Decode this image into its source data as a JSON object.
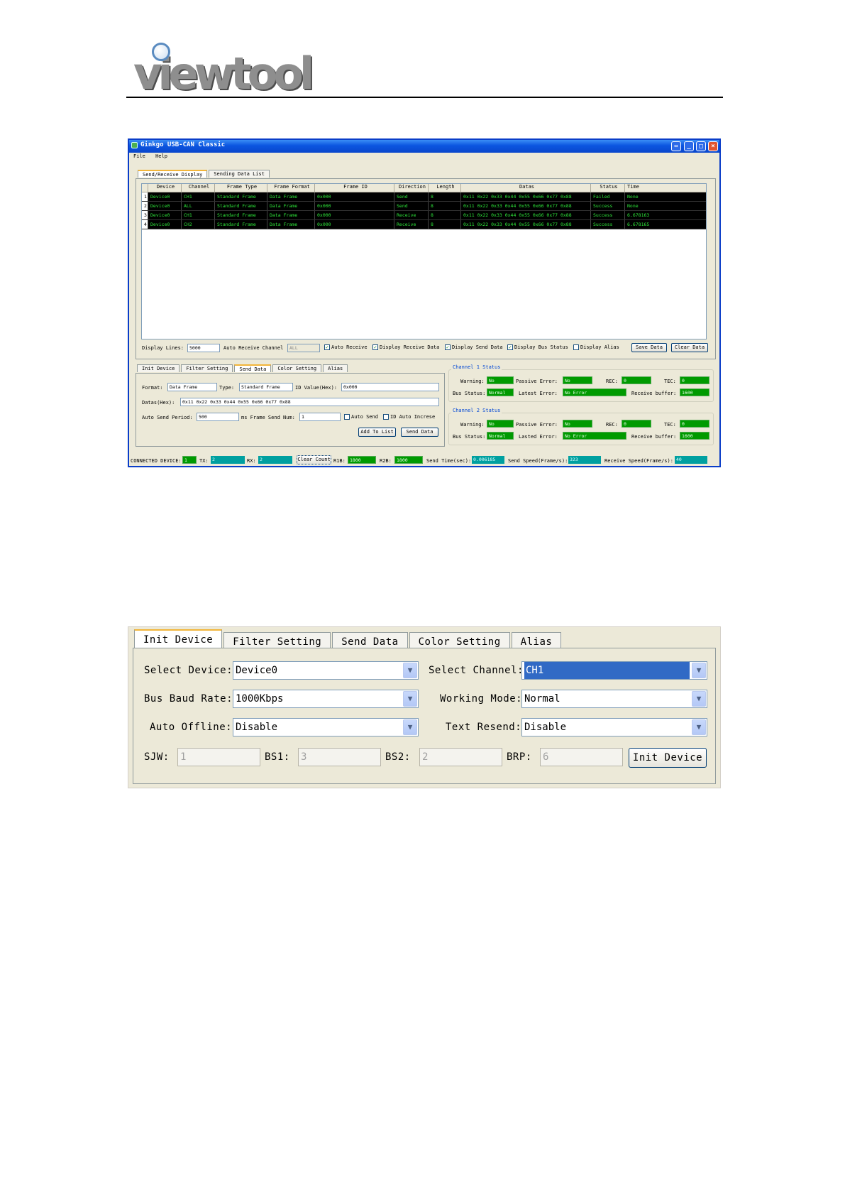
{
  "logo": {
    "text": "viewtool"
  },
  "win1": {
    "title": "Ginkgo USB-CAN Classic",
    "menu": [
      "File",
      "Help"
    ],
    "main_tabs": [
      "Send/Receive Display",
      "Sending Data List"
    ],
    "grid": {
      "columns": [
        "Device",
        "Channel",
        "Frame Type",
        "Frame Format",
        "Frame ID",
        "Direction",
        "Length",
        "Datas",
        "Status",
        "Time"
      ],
      "rows": [
        {
          "n": "1",
          "device": "Device0",
          "channel": "CH1",
          "type": "Standard Frame",
          "format": "Data Frame",
          "id": "0x000",
          "dir": "Send",
          "len": "8",
          "data": "0x11 0x22 0x33 0x44 0x55 0x66 0x77 0x88",
          "status": "Failed",
          "time": "None"
        },
        {
          "n": "2",
          "device": "Device0",
          "channel": "ALL",
          "type": "Standard Frame",
          "format": "Data Frame",
          "id": "0x000",
          "dir": "Send",
          "len": "8",
          "data": "0x11 0x22 0x33 0x44 0x55 0x66 0x77 0x88",
          "status": "Success",
          "time": "None"
        },
        {
          "n": "3",
          "device": "Device0",
          "channel": "CH1",
          "type": "Standard Frame",
          "format": "Data Frame",
          "id": "0x000",
          "dir": "Receive",
          "len": "8",
          "data": "0x11 0x22 0x33 0x44 0x55 0x66 0x77 0x88",
          "status": "Success",
          "time": "6.678163"
        },
        {
          "n": "4",
          "device": "Device0",
          "channel": "CH2",
          "type": "Standard Frame",
          "format": "Data Frame",
          "id": "0x000",
          "dir": "Receive",
          "len": "8",
          "data": "0x11 0x22 0x33 0x44 0x55 0x66 0x77 0x88",
          "status": "Success",
          "time": "6.678165"
        }
      ]
    },
    "display_bar": {
      "lines_label": "Display Lines:",
      "lines_value": "5000",
      "auto_recv_label": "Auto Receive Channel",
      "auto_recv_value": "ALL",
      "auto_receive": "Auto Receive",
      "display_receive": "Display Receive Data",
      "display_send": "Display Send Data",
      "display_bus": "Display Bus Status",
      "display_alias": "Display Alias",
      "save": "Save Data",
      "clear": "Clear Data"
    },
    "lower_tabs": [
      "Init Device",
      "Filter Setting",
      "Send Data",
      "Color Setting",
      "Alias"
    ],
    "send": {
      "format_label": "Format:",
      "format_value": "Data Frame",
      "type_label": "Type:",
      "type_value": "Standard Frame",
      "id_label": "ID Value(Hex):",
      "id_value": "0x000",
      "datas_label": "Datas(Hex):",
      "datas_value": "0x11 0x22 0x33 0x44 0x55 0x66 0x77 0x88",
      "period_label": "Auto Send Period:",
      "period_value": "500",
      "num_label": "ms Frame Send Num:",
      "num_value": "1",
      "auto_send": "Auto Send",
      "id_auto": "ID Auto Increse",
      "add": "Add To List",
      "send": "Send Data"
    },
    "ch1": {
      "title": "Channel 1 Status",
      "warning_l": "Warning:",
      "warning": "No",
      "passive_l": "Passive Error:",
      "passive": "No",
      "rec_l": "REC:",
      "rec": "0",
      "tec_l": "TEC:",
      "tec": "0",
      "bus_l": "Bus Status:",
      "bus": "Normal",
      "latest_l": "Latest Error:",
      "latest": "No Error",
      "buf_l": "Receive buffer:",
      "buf": "1600"
    },
    "ch2": {
      "title": "Channel 2 Status",
      "warning_l": "Warning:",
      "warning": "No",
      "passive_l": "Passive Error:",
      "passive": "No",
      "rec_l": "REC:",
      "rec": "0",
      "tec_l": "TEC:",
      "tec": "0",
      "bus_l": "Bus Status:",
      "bus": "Normal",
      "latest_l": "Lasted Error:",
      "latest": "No Error",
      "buf_l": "Receive buffer:",
      "buf": "1600"
    },
    "status": {
      "conn_l": "CONNECTED DEVICE:",
      "conn": "1",
      "tx_l": "TX:",
      "tx": "2",
      "rx_l": "RX:",
      "rx": "2",
      "clear": "Clear Count",
      "r1_l": "R1B:",
      "r1": "1800",
      "r2_l": "R2B:",
      "r2": "1800",
      "stime_l": "Send Time(sec):",
      "stime": "0.006185",
      "sspeed_l": "Send Speed(Frame/s):",
      "sspeed": "323",
      "rspeed_l": "Receive Speed(Frame/s):",
      "rspeed": "40"
    }
  },
  "win2": {
    "tabs": [
      "Init Device",
      "Filter Setting",
      "Send Data",
      "Color Setting",
      "Alias"
    ],
    "select_device_l": "Select Device:",
    "select_device": "Device0",
    "select_channel_l": "Select Channel:",
    "select_channel": "CH1",
    "baud_l": "Bus Baud Rate:",
    "baud": "1000Kbps",
    "mode_l": "Working Mode:",
    "mode": "Normal",
    "offline_l": "Auto Offline:",
    "offline": "Disable",
    "resend_l": "Text Resend:",
    "resend": "Disable",
    "sjw_l": "SJW:",
    "sjw": "1",
    "bs1_l": "BS1:",
    "bs1": "3",
    "bs2_l": "BS2:",
    "bs2": "2",
    "brp_l": "BRP:",
    "brp": "6",
    "init": "Init Device"
  }
}
